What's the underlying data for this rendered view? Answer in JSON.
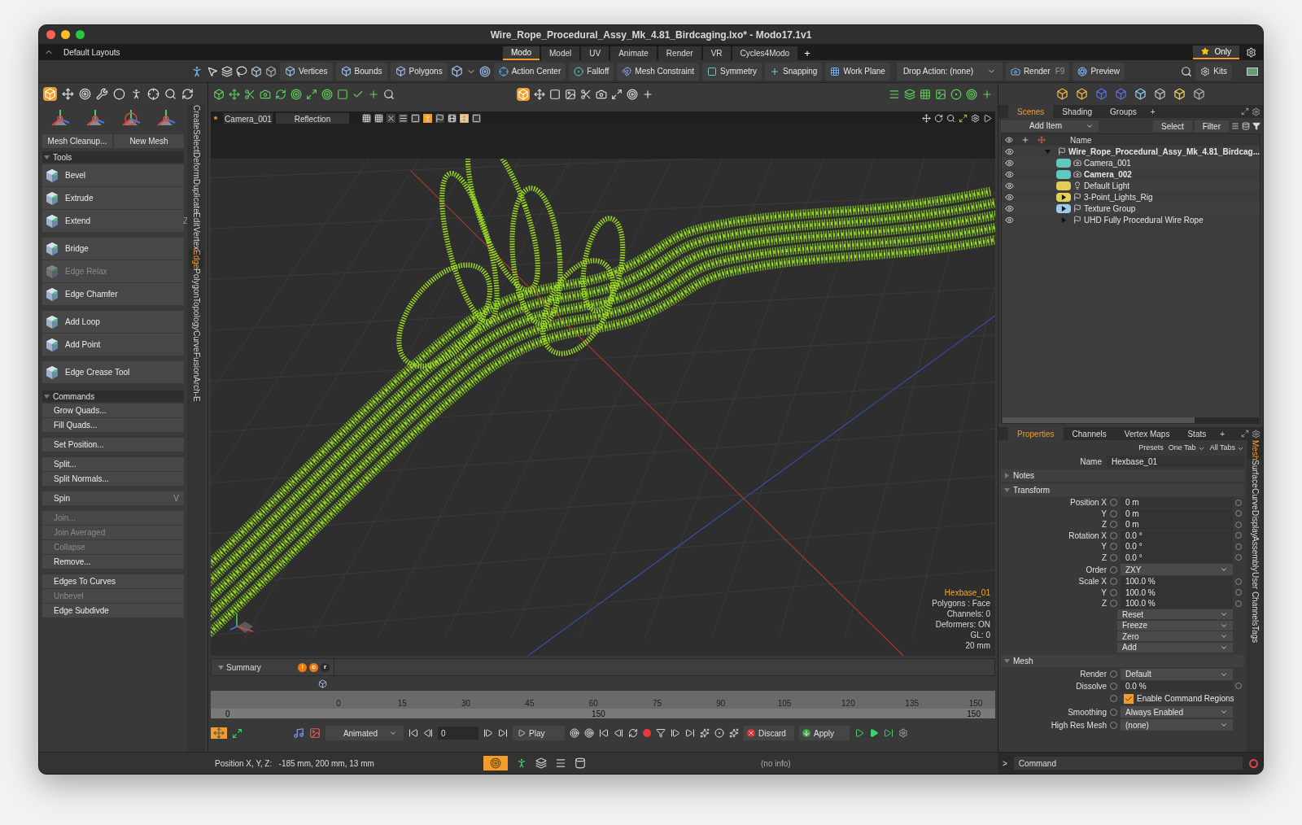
{
  "window": {
    "title": "Wire_Rope_Procedural_Assy_Mk_4.81_Birdcaging.lxo* - Modo17.1v1"
  },
  "layout_bar": {
    "menu": "Default Layouts",
    "tabs": [
      {
        "label": "Modo",
        "selected": true
      },
      {
        "label": "Model",
        "selected": false
      },
      {
        "label": "UV",
        "selected": false
      },
      {
        "label": "Animate",
        "selected": false
      },
      {
        "label": "Render",
        "selected": false
      },
      {
        "label": "VR",
        "selected": false
      },
      {
        "label": "Cycles4Modo",
        "selected": false
      }
    ],
    "add_tab": "+",
    "favorite": "Only"
  },
  "toolbar": {
    "selection_modes": [
      "Vertices",
      "Bounds",
      "Polygons"
    ],
    "tools": [
      "Action Center",
      "Falloff",
      "Mesh Constraint",
      "Symmetry",
      "Snapping",
      "Work Plane"
    ],
    "drop_action": "Drop Action: (none)",
    "render": {
      "label": "Render",
      "shortcut": "F9"
    },
    "preview": "Preview",
    "kits": "Kits"
  },
  "left_panel": {
    "quick_buttons": [
      "Mesh Cleanup...",
      "New Mesh"
    ],
    "sections": [
      {
        "title": "Tools",
        "kind": "tools",
        "expanded": true,
        "groups": [
          [
            {
              "label": "Bevel",
              "disabled": false
            },
            {
              "label": "Extrude",
              "disabled": false
            },
            {
              "label": "Extend",
              "disabled": false,
              "shortcut": "Z"
            }
          ],
          [
            {
              "label": "Bridge",
              "disabled": false
            },
            {
              "label": "Edge Relax",
              "disabled": true
            },
            {
              "label": "Edge Chamfer",
              "disabled": false
            }
          ],
          [
            {
              "label": "Add Loop",
              "disabled": false
            },
            {
              "label": "Add Point",
              "disabled": false
            }
          ],
          [
            {
              "label": "Edge Crease Tool",
              "disabled": false
            }
          ]
        ]
      },
      {
        "title": "Commands",
        "kind": "commands",
        "expanded": true,
        "groups": [
          [
            {
              "label": "Grow Quads...",
              "disabled": false
            },
            {
              "label": "Fill Quads...",
              "disabled": false
            }
          ],
          [
            {
              "label": "Set Position...",
              "disabled": false
            }
          ],
          [
            {
              "label": "Split...",
              "disabled": false
            },
            {
              "label": "Split Normals...",
              "disabled": false
            }
          ],
          [
            {
              "label": "Spin",
              "disabled": false,
              "shortcut": "V"
            }
          ],
          [
            {
              "label": "Join...",
              "disabled": true
            },
            {
              "label": "Join Averaged",
              "disabled": true
            },
            {
              "label": "Collapse",
              "disabled": true
            },
            {
              "label": "Remove...",
              "disabled": false
            }
          ],
          [
            {
              "label": "Edges To Curves",
              "disabled": false
            },
            {
              "label": "Unbevel",
              "disabled": true
            },
            {
              "label": "Edge Subdivde",
              "disabled": false
            }
          ]
        ]
      }
    ],
    "side_tabs": [
      {
        "label": "Create",
        "selected": false
      },
      {
        "label": "Select",
        "selected": false
      },
      {
        "label": "Deform",
        "selected": false
      },
      {
        "label": "Duplicate",
        "selected": false
      },
      {
        "label": "Edit",
        "selected": false
      },
      {
        "label": "Vertex",
        "selected": false
      },
      {
        "label": "Edge",
        "selected": true
      },
      {
        "label": "Polygon",
        "selected": false
      },
      {
        "label": "Topology",
        "selected": false
      },
      {
        "label": "Curve",
        "selected": false
      },
      {
        "label": "Fusion",
        "selected": false
      },
      {
        "label": "Arch-E",
        "selected": false
      }
    ]
  },
  "viewport": {
    "camera": "Camera_001",
    "shading": "Reflection",
    "info": {
      "item": "Hexbase_01",
      "lines": [
        "Polygons : Face",
        "Channels: 0",
        "Deformers: ON",
        "GL: 0",
        "20 mm"
      ]
    }
  },
  "timeline": {
    "summary": "Summary",
    "markers": [
      {
        "label": "i",
        "color": "#f07a10"
      },
      {
        "label": "c",
        "color": "#f07a10"
      },
      {
        "label": "r",
        "color": "#2a2a2a"
      }
    ],
    "ruler": [
      "0",
      "15",
      "30",
      "45",
      "60",
      "75",
      "90",
      "105",
      "120",
      "135",
      "150"
    ],
    "range": [
      "0",
      "150",
      "150"
    ]
  },
  "transport": {
    "mode": "Animated",
    "frame": "0",
    "play": "Play",
    "discard": "Discard",
    "apply": "Apply"
  },
  "scenes": {
    "tabs": [
      {
        "label": "Scenes",
        "selected": true
      },
      {
        "label": "Shading",
        "selected": false
      },
      {
        "label": "Groups",
        "selected": false
      }
    ],
    "add_tab": "+",
    "add_item": "Add Item",
    "select": "Select",
    "filter": "Filter",
    "column": "Name",
    "tree": [
      {
        "label": "Wire_Rope_Procedural_Assy_Mk_4.81_Birdcag...",
        "kind": "scene",
        "bold": true,
        "expanded": true,
        "children": [
          {
            "label": "Camera_001",
            "kind": "camera",
            "bold": false,
            "color": "#5fc9c0"
          },
          {
            "label": "Camera_002",
            "kind": "camera",
            "bold": true,
            "color": "#5fc9c0"
          },
          {
            "label": "Default Light",
            "kind": "light",
            "bold": false,
            "color": "#e3cf55"
          },
          {
            "label": "3-Point_Lights_Rig",
            "kind": "group",
            "bold": false,
            "expanded": false,
            "color": "#e3cf55"
          },
          {
            "label": "Texture Group",
            "kind": "group",
            "bold": false,
            "expanded": false,
            "color": "#9ccbe8"
          },
          {
            "label": "UHD Fully Procedural Wire Rope",
            "kind": "group",
            "bold": false,
            "expanded": false
          }
        ]
      }
    ]
  },
  "properties": {
    "tabs": [
      {
        "label": "Properties",
        "selected": true
      },
      {
        "label": "Channels",
        "selected": false
      },
      {
        "label": "Vertex Maps",
        "selected": false
      },
      {
        "label": "Stats",
        "selected": false
      }
    ],
    "add_tab": "+",
    "presets": "Presets",
    "one_tab": "One Tab",
    "all_tabs": "All Tabs",
    "name": {
      "label": "Name",
      "value": "Hexbase_01"
    },
    "sections": [
      {
        "title": "Notes",
        "expanded": false
      },
      {
        "title": "Transform",
        "expanded": true,
        "rows": [
          {
            "kind": "field",
            "label": "Position X",
            "value": "0 m"
          },
          {
            "kind": "field",
            "label": "Y",
            "value": "0 m"
          },
          {
            "kind": "field",
            "label": "Z",
            "value": "0 m"
          },
          {
            "kind": "field",
            "label": "Rotation X",
            "value": "0.0 °"
          },
          {
            "kind": "field",
            "label": "Y",
            "value": "0.0 °"
          },
          {
            "kind": "field",
            "label": "Z",
            "value": "0.0 °"
          },
          {
            "kind": "dropdown",
            "label": "Order",
            "value": "ZXY"
          },
          {
            "kind": "field",
            "label": "Scale X",
            "value": "100.0 %"
          },
          {
            "kind": "field",
            "label": "Y",
            "value": "100.0 %"
          },
          {
            "kind": "field",
            "label": "Z",
            "value": "100.0 %"
          },
          {
            "kind": "action",
            "value": "Reset"
          },
          {
            "kind": "action",
            "value": "Freeze"
          },
          {
            "kind": "action",
            "value": "Zero"
          },
          {
            "kind": "action",
            "value": "Add"
          }
        ]
      },
      {
        "title": "Mesh",
        "expanded": true,
        "rows": [
          {
            "kind": "dropdown",
            "label": "Render",
            "value": "Default"
          },
          {
            "kind": "field",
            "label": "Dissolve",
            "value": "0.0 %"
          },
          {
            "kind": "checkbox",
            "label": "Enable Command Regions",
            "checked": true
          },
          {
            "kind": "dropdown",
            "label": "Smoothing",
            "value": "Always Enabled"
          },
          {
            "kind": "dropdown",
            "label": "High Res Mesh",
            "value": "(none)"
          }
        ]
      }
    ],
    "side_tabs": [
      {
        "label": "Mesh",
        "selected": true
      },
      {
        "label": "Surface",
        "selected": false
      },
      {
        "label": "Curve",
        "selected": false
      },
      {
        "label": "Display",
        "selected": false
      },
      {
        "label": "Assembly",
        "selected": false
      },
      {
        "label": "User Channels",
        "selected": false
      },
      {
        "label": "Tags",
        "selected": false
      }
    ]
  },
  "status_bar": {
    "position": "Position X, Y, Z:   -185 mm, 200 mm, 13 mm",
    "info": "(no info)",
    "prompt": ">",
    "command": {
      "placeholder": "Command"
    }
  }
}
